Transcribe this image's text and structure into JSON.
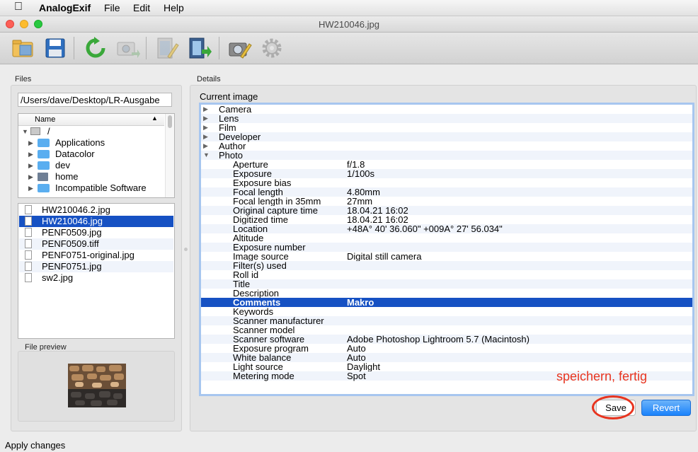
{
  "menubar": {
    "app_name": "AnalogExif",
    "menus": [
      "File",
      "Edit",
      "Help"
    ]
  },
  "window": {
    "title": "HW210046.jpg"
  },
  "toolbar": {
    "buttons": [
      "open-folder-icon",
      "save-icon",
      "refresh-icon",
      "copy-metadata-icon",
      "edit-film-icon",
      "film-apply-icon",
      "camera-edit-icon",
      "gear-icon"
    ]
  },
  "files_panel": {
    "label": "Files",
    "path": "/Users/dave/Desktop/LR-Ausgabe",
    "tree_header": "Name",
    "tree_root": "/",
    "tree_items": [
      "Applications",
      "Datacolor",
      "dev",
      "home",
      "Incompatible Software"
    ],
    "files": [
      "HW210046.2.jpg",
      "HW210046.jpg",
      "PENF0509.jpg",
      "PENF0509.tiff",
      "PENF0751-original.jpg",
      "PENF0751.jpg",
      "sw2.jpg"
    ],
    "selected_file": "HW210046.jpg",
    "preview_label": "File preview"
  },
  "details_panel": {
    "label": "Details",
    "current_image_label": "Current image",
    "groups": [
      "Camera",
      "Lens",
      "Film",
      "Developer",
      "Author",
      "Photo"
    ],
    "expanded_group": "Photo",
    "photo_fields": [
      {
        "key": "Aperture",
        "value": "f/1.8"
      },
      {
        "key": "Exposure",
        "value": "1/100s"
      },
      {
        "key": "Exposure bias",
        "value": ""
      },
      {
        "key": "Focal length",
        "value": "4.80mm"
      },
      {
        "key": "Focal length in 35mm",
        "value": "27mm"
      },
      {
        "key": "Original capture time",
        "value": "18.04.21 16:02"
      },
      {
        "key": "Digitized time",
        "value": "18.04.21 16:02"
      },
      {
        "key": "Location",
        "value": "+48A° 40' 36.060\" +009A° 27' 56.034\""
      },
      {
        "key": "Altitude",
        "value": ""
      },
      {
        "key": "Exposure number",
        "value": ""
      },
      {
        "key": "Image source",
        "value": "Digital still camera"
      },
      {
        "key": "Filter(s) used",
        "value": ""
      },
      {
        "key": "Roll id",
        "value": ""
      },
      {
        "key": "Title",
        "value": ""
      },
      {
        "key": "Description",
        "value": ""
      },
      {
        "key": "Comments",
        "value": "Makro"
      },
      {
        "key": "Keywords",
        "value": ""
      },
      {
        "key": "Scanner manufacturer",
        "value": ""
      },
      {
        "key": "Scanner model",
        "value": ""
      },
      {
        "key": "Scanner software",
        "value": "Adobe Photoshop Lightroom 5.7 (Macintosh)"
      },
      {
        "key": "Exposure program",
        "value": "Auto"
      },
      {
        "key": "White balance",
        "value": "Auto"
      },
      {
        "key": "Light source",
        "value": "Daylight"
      },
      {
        "key": "Metering mode",
        "value": "Spot"
      }
    ],
    "selected_field": "Comments"
  },
  "buttons": {
    "save": "Save",
    "revert": "Revert"
  },
  "annotation": {
    "text": "speichern, fertig",
    "color": "#e8341f"
  },
  "status_bar": {
    "text": "Apply changes"
  },
  "colors": {
    "selection": "#1651c3",
    "alt_row": "#f0f4fb",
    "focus_ring": "#a7c6ef"
  }
}
